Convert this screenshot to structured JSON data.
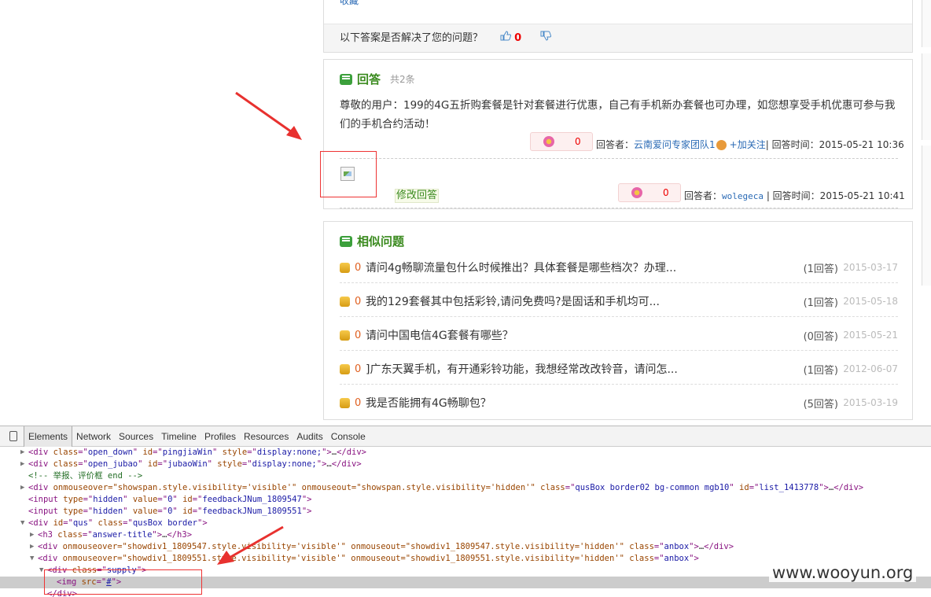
{
  "top": {
    "collect_label": "收藏",
    "feedback_question": "以下答案是否解决了您的问题？",
    "up_count": "0"
  },
  "answers": {
    "title": "回答",
    "count": "共2条",
    "first": {
      "text": "尊敬的用户：199的4G五折购套餐是针对套餐进行优惠，自己有手机新办套餐也可办理，如您想享受手机优惠可参与我们的手机合约活动！",
      "flower_count": "0",
      "answerer_label": "回答者：",
      "answerer_name": "云南爱问专家团队1",
      "follow_label": "+加关注",
      "time_label": "| 回答时间：2015-05-21 10:36"
    },
    "second": {
      "modify_label": "修改回答",
      "flower_count": "0",
      "answerer_label": "回答者：",
      "answerer_name": "wolegeca",
      "time_label": "| 回答时间：2015-05-21 10:41"
    }
  },
  "similar": {
    "title": "相似问题",
    "items": [
      {
        "num": "0",
        "text": "请问4g畅聊流量包什么时候推出？具体套餐是哪些档次？办理...",
        "answers": "(1回答)",
        "date": "2015-03-17"
      },
      {
        "num": "0",
        "text": "我的129套餐其中包括彩铃,请问免费吗?是固话和手机均可...",
        "answers": "(1回答)",
        "date": "2015-05-18"
      },
      {
        "num": "0",
        "text": "请问中国电信4G套餐有哪些？",
        "answers": "(0回答)",
        "date": "2015-05-21"
      },
      {
        "num": "0",
        "text": "]广东天翼手机，有开通彩铃功能，我想经常改改铃音，请问怎...",
        "answers": "(1回答)",
        "date": "2012-06-07"
      },
      {
        "num": "0",
        "text": "我是否能拥有4G畅聊包？",
        "answers": "(5回答)",
        "date": "2015-03-19"
      }
    ]
  },
  "devtools": {
    "tabs": [
      "Elements",
      "Network",
      "Sources",
      "Timeline",
      "Profiles",
      "Resources",
      "Audits",
      "Console"
    ],
    "lines": {
      "l1_a": "<div ",
      "l1_b": "class",
      "l1_c": "=\"",
      "l1_d": "open_down",
      "l1_e": "\" ",
      "l1_f": "id",
      "l1_g": "=\"",
      "l1_h": "pingjiaWin",
      "l1_i": "\" ",
      "l1_j": "style",
      "l1_k": "=\"",
      "l1_l": "display:none;",
      "l1_m": "\">…</div>",
      "l2_full_a": "<div ",
      "l2_b": "open_jubao",
      "l2_h": "jubaoWin",
      "l3": "<!-- 举报、评价框 end -->",
      "l4_events": "onmouseover=\"showspan.style.visibility='visible'\" onmouseout=\"showspan.style.visibility='hidden'\"",
      "l4_class": "qusBox border02 bg-common mgb10",
      "l4_id": "list_1413778",
      "l5_value": "0",
      "l5_id": "feedbackJNum_1809547",
      "l6_value": "0",
      "l6_id": "feedbackJNum_1809551",
      "l7_id": "qus",
      "l7_class": "qusBox border",
      "l8_class": "answer-title",
      "l9_events": "onmouseover=\"showdiv1_1809547.style.visibility='visible'\" onmouseout=\"showdiv1_1809547.style.visibility='hidden'\"",
      "l9_class": "anbox",
      "l10_events": "onmouseover=\"showdiv1_1809551.style.visibility='visible'\" onmouseout=\"showdiv1_1809551.style.visibility='hidden'\"",
      "l10_class": "anbox",
      "l11_class": "supply",
      "l12_src": "#"
    }
  },
  "watermark": "www.wooyun.org"
}
